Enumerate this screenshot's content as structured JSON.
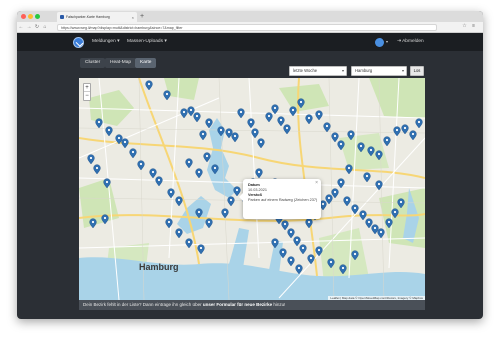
{
  "browser": {
    "tab_title": "Falschparker-Karte Hamburg",
    "url": "https://www.weg.li/map?display=multi&district=hamburg&since=7&map_filter",
    "new_tab_symbol": "+"
  },
  "navbar": {
    "menu_reports": "Meldungen",
    "menu_bulk_upload": "Massen-Uploads",
    "logout": "Abmelden"
  },
  "view_tabs": [
    {
      "label": "Cluster",
      "active": false
    },
    {
      "label": "Heat-Map",
      "active": false
    },
    {
      "label": "Karte",
      "active": true
    }
  ],
  "filters": {
    "period_value": "letzte Woche",
    "district_value": "Hamburg",
    "go_label": "Los"
  },
  "map": {
    "zoom_in": "+",
    "zoom_out": "−",
    "city_label": "Hamburg",
    "attribution": "Leaflet | Map data © OpenStreetMap contributors, Imagery © Mapbox",
    "marker_color": "#2f6fb0",
    "popup": {
      "close": "×",
      "date_label": "Datum",
      "date_value": "10.03.2021",
      "violation_label": "Verstoß",
      "violation_value": "Parken auf einem Radweg (Zeichen 237)"
    }
  },
  "footer": {
    "text_before": "Dein Bezirk fehlt in der Liste? Dann eintrage ihn gleich über",
    "link": "unser Formular für neue Bezirke",
    "text_after": "hinzu!"
  }
}
